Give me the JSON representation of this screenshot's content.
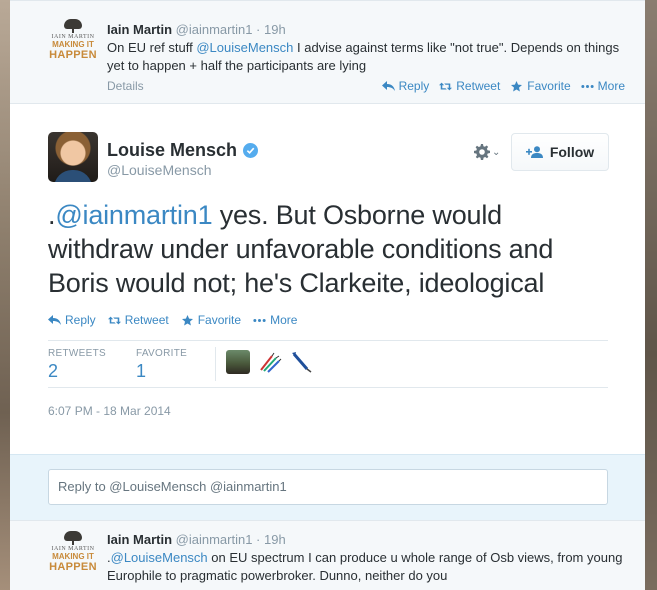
{
  "prev_tweet": {
    "logo": {
      "l1": "IAIN MARTIN",
      "l2": "MAKING IT",
      "l3": "HAPPEN"
    },
    "name": "Iain Martin",
    "handle": "@iainmartin1",
    "time": "· 19h",
    "text_before": "On EU ref stuff ",
    "mention": "@LouiseMensch",
    "text_after": " I advise against terms like \"not true\". Depends on things yet to happen + half the participants are lying",
    "details_label": "Details",
    "actions": {
      "reply": "Reply",
      "retweet": "Retweet",
      "favorite": "Favorite",
      "more": "More"
    }
  },
  "main_tweet": {
    "author": {
      "name": "Louise Mensch",
      "handle": "@LouiseMensch"
    },
    "follow_label": "Follow",
    "text_prefix": ".",
    "mention": "@iainmartin1",
    "text": " yes. But Osborne would withdraw under unfavorable conditions and Boris would not; he's Clarkeite, ideological",
    "actions": {
      "reply": "Reply",
      "retweet": "Retweet",
      "favorite": "Favorite",
      "more": "More"
    },
    "stats": {
      "retweets_label": "RETWEETS",
      "retweets_value": "2",
      "favorite_label": "FAVORITE",
      "favorite_value": "1"
    },
    "timestamp": "6:07 PM - 18 Mar 2014"
  },
  "reply": {
    "placeholder": "Reply to @LouiseMensch @iainmartin1"
  },
  "next_tweet": {
    "logo": {
      "l1": "IAIN MARTIN",
      "l2": "MAKING IT",
      "l3": "HAPPEN"
    },
    "name": "Iain Martin",
    "handle": "@iainmartin1",
    "time": "· 19h",
    "text_prefix": ".",
    "mention": "@LouiseMensch",
    "text_after": " on EU spectrum I can produce u whole range of Osb views, from young Europhile to pragmatic powerbroker. Dunno, neither do you"
  },
  "colors": {
    "accent": "#3b88c3",
    "verified": "#55acee",
    "reply_bg": "#e8f4fb",
    "muted": "#8899a6"
  }
}
